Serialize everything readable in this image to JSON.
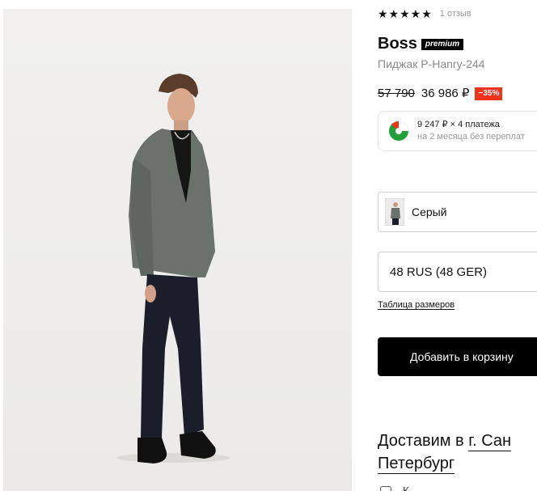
{
  "product": {
    "image_alt": "photo",
    "rating": {
      "stars": "★★★★★",
      "reviews": "1 отзыв"
    },
    "brand": "Boss",
    "brand_badge": "premium",
    "name": "Пиджак P-Hanry-244",
    "price": {
      "old": "57 790",
      "current": "36 986 ₽",
      "discount": "−35%"
    },
    "installment": {
      "line1": "9 247 ₽ × 4 платежа",
      "line2": "на 2 месяца без переплат",
      "icon": "split-payment-icon"
    },
    "color": {
      "label": "Серый",
      "swatch": "gray-jacket-thumbnail"
    },
    "size": {
      "label": "48 RUS (48 GER)"
    },
    "size_table_link": "Таблица размеров",
    "add_to_cart": "Добавить в корзину"
  },
  "delivery": {
    "prefix": "Доставим в",
    "city_part1": "г. Сан",
    "city_part2": "Петербург",
    "bottom_text": "К"
  },
  "colors": {
    "discount": "#f0331c",
    "button": "#000000",
    "jacket": "#6b716b",
    "trousers": "#1b1e2a",
    "installment_green": "#21a038"
  }
}
